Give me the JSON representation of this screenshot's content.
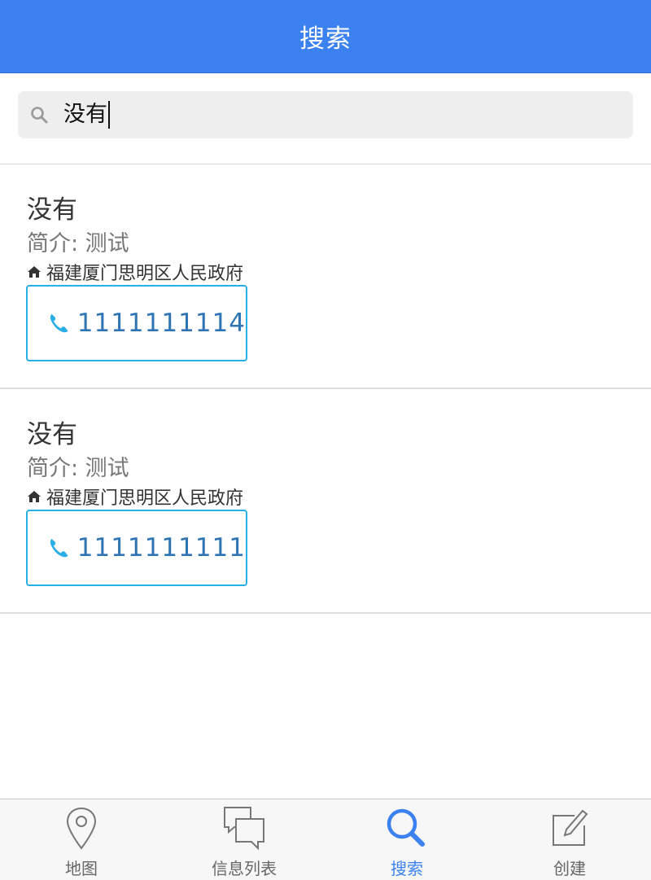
{
  "header": {
    "title": "搜索"
  },
  "search": {
    "query": "没有",
    "icon": "search-icon"
  },
  "results": [
    {
      "name": "没有",
      "intro": "简介: 测试",
      "address": "福建厦门思明区人民政府",
      "phone": "1111111114"
    },
    {
      "name": "没有",
      "intro": "简介: 测试",
      "address": "福建厦门思明区人民政府",
      "phone": "1111111111"
    }
  ],
  "tabs": [
    {
      "label": "地图",
      "icon": "map-pin-icon",
      "active": false
    },
    {
      "label": "信息列表",
      "icon": "chat-bubbles-icon",
      "active": false
    },
    {
      "label": "搜索",
      "icon": "search-icon",
      "active": true
    },
    {
      "label": "创建",
      "icon": "edit-icon",
      "active": false
    }
  ],
  "colors": {
    "accent": "#3b82f0",
    "phone_border": "#29aee6",
    "phone_text": "#2f75b5",
    "phone_icon": "#29aee6"
  }
}
